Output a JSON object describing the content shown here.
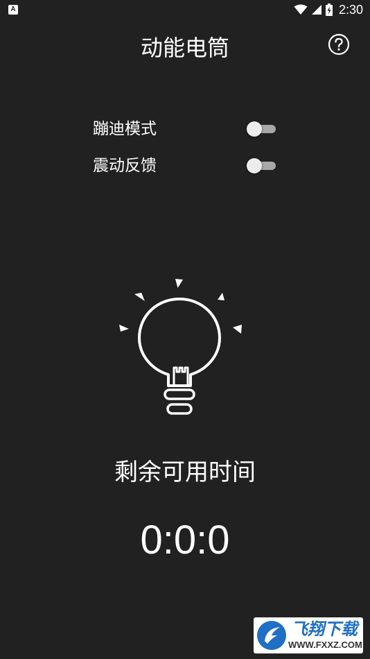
{
  "status_bar": {
    "notification_icon": "a-letter-icon",
    "notification_glyph": "A",
    "icons": [
      "wifi-icon",
      "cell-signal-icon",
      "battery-icon"
    ],
    "time": "2:30"
  },
  "header": {
    "title": "动能电筒",
    "help_icon": "help-circle-icon"
  },
  "settings": [
    {
      "label": "蹦迪模式",
      "enabled": false
    },
    {
      "label": "震动反馈",
      "enabled": false
    }
  ],
  "flashlight": {
    "icon": "light-bulb-icon",
    "remaining_label": "剩余可用时间",
    "remaining_value": "0:0:0"
  },
  "watermark": {
    "brand": "飞翔下载",
    "url": "WWW.FXXZ.COM",
    "emblem": "fxxz-logo-icon"
  },
  "colors": {
    "background": "#212121",
    "text": "#ffffff",
    "toggle_track_off": "#a8a8a8",
    "toggle_thumb_off": "#ececec",
    "watermark_brand": "#1f6fc4"
  }
}
